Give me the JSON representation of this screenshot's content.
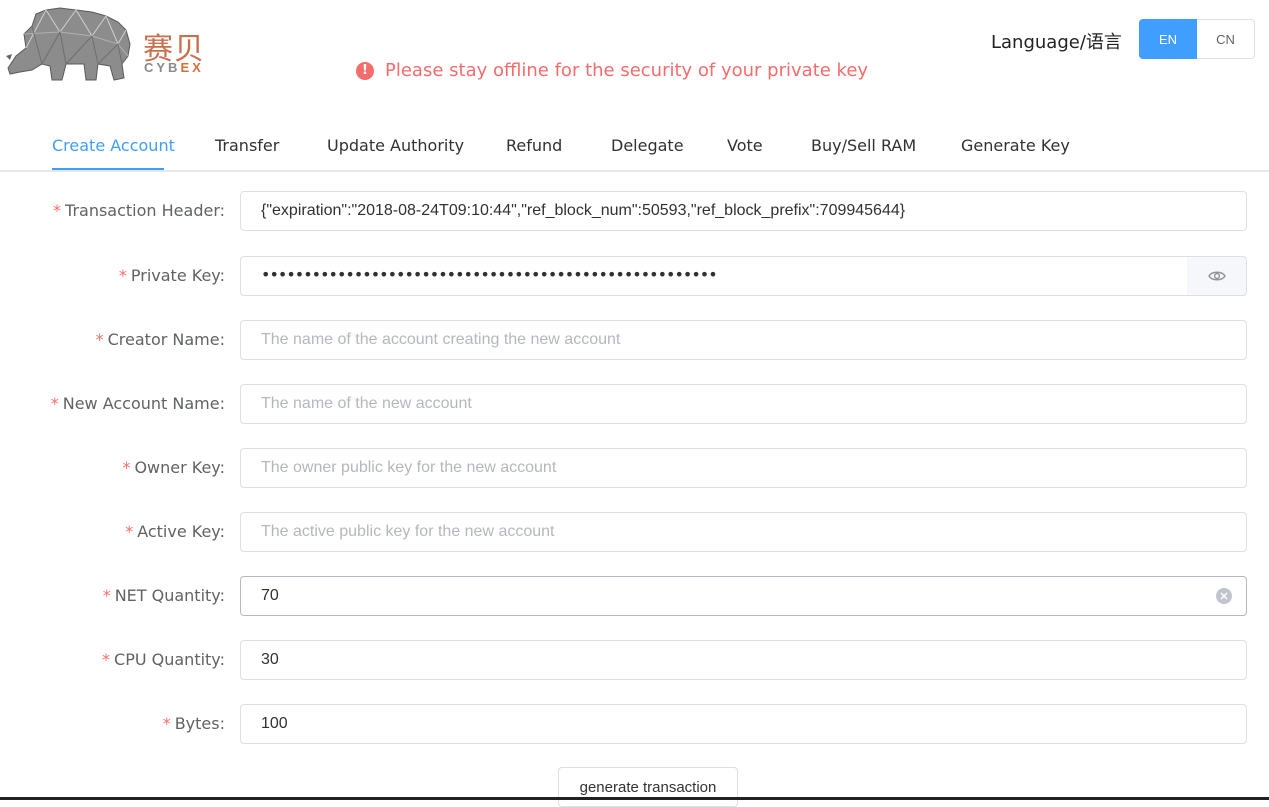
{
  "logo": {
    "text_cn": "赛贝",
    "text_en_1": "CYB",
    "text_en_2": "EX"
  },
  "warning": {
    "text": "Please stay offline for the security of your private key"
  },
  "language": {
    "label": "Language/语言",
    "options": [
      "EN",
      "CN"
    ],
    "selected": "EN"
  },
  "tabs": [
    {
      "label": "Create Account",
      "active": true
    },
    {
      "label": "Transfer"
    },
    {
      "label": "Update Authority"
    },
    {
      "label": "Refund"
    },
    {
      "label": "Delegate"
    },
    {
      "label": "Vote"
    },
    {
      "label": "Buy/Sell RAM"
    },
    {
      "label": "Generate Key"
    }
  ],
  "form": {
    "transaction_header": {
      "label": "Transaction Header:",
      "value": "{\"expiration\":\"2018-08-24T09:10:44\",\"ref_block_num\":50593,\"ref_block_prefix\":709945644}"
    },
    "private_key": {
      "label": "Private Key:",
      "value": "••••••••••••••••••••••••••••••••••••••••••••••••••••••"
    },
    "creator_name": {
      "label": "Creator Name:",
      "placeholder": "The name of the account creating the new account"
    },
    "new_account_name": {
      "label": "New Account Name:",
      "placeholder": "The name of the new account"
    },
    "owner_key": {
      "label": "Owner Key:",
      "placeholder": "The owner public key for the new account"
    },
    "active_key": {
      "label": "Active Key:",
      "placeholder": "The active public key for the new account"
    },
    "net_quantity": {
      "label": "NET Quantity:",
      "value": "70"
    },
    "cpu_quantity": {
      "label": "CPU Quantity:",
      "value": "30"
    },
    "bytes": {
      "label": "Bytes:",
      "value": "100"
    }
  },
  "required_mark": "*",
  "submit_label": "generate transaction",
  "colors": {
    "accent": "#409eff",
    "danger": "#f56c6c",
    "logo": "#c8704c"
  }
}
